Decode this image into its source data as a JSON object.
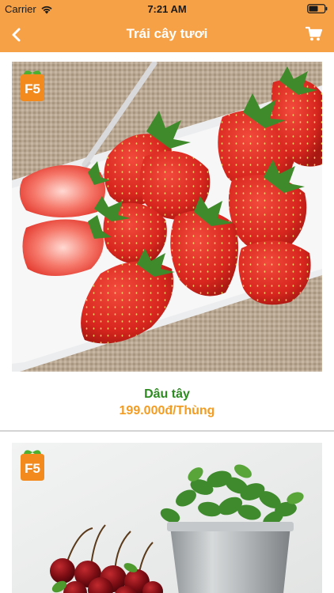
{
  "status_bar": {
    "carrier": "Carrier",
    "time": "7:21 AM"
  },
  "nav": {
    "title": "Trái cây tươi",
    "back_icon": "chevron-left-icon",
    "cart_icon": "cart-icon"
  },
  "colors": {
    "header_bg": "#f7a146",
    "name_green": "#2e8b22",
    "price_orange": "#f39c22"
  },
  "logo": {
    "text": "F5"
  },
  "products": [
    {
      "name": "Dâu tây",
      "price": "199.000đ/Thùng"
    }
  ]
}
